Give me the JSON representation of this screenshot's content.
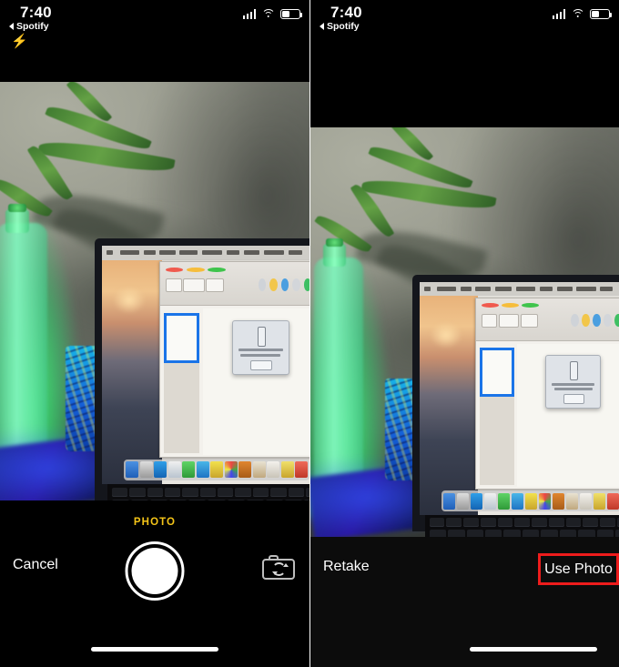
{
  "panels": {
    "left": {
      "name": "camera-capture-screen",
      "status": {
        "time": "7:40",
        "back_app": "Spotify",
        "flash_icon": "lightning-bolt-icon",
        "signal_icon": "cellular-signal-icon",
        "wifi_icon": "wifi-icon",
        "battery_icon": "battery-icon",
        "battery_level": "40%"
      },
      "mode_label": "PHOTO",
      "cancel_label": "Cancel",
      "shutter_name": "shutter-button",
      "flip_icon": "camera-flip-icon",
      "photo_alt": "Desk photo with plant in glowing green bottle, blue Pokemon mug and MacBook showing document app"
    },
    "right": {
      "name": "photo-review-screen",
      "status": {
        "time": "7:40",
        "back_app": "Spotify",
        "signal_icon": "cellular-signal-icon",
        "wifi_icon": "wifi-icon",
        "battery_icon": "battery-icon",
        "battery_level": "40%"
      },
      "retake_label": "Retake",
      "use_photo_label": "Use Photo",
      "highlight_color": "#ee1c1c",
      "photo_alt": "Captured photo preview of desk with plant, bottle and MacBook"
    }
  },
  "colors": {
    "mode_yellow": "#f5c518",
    "highlight_red": "#ee1c1c",
    "background": "#000000",
    "text_white": "#ffffff",
    "selection_blue": "#1a74e8"
  }
}
